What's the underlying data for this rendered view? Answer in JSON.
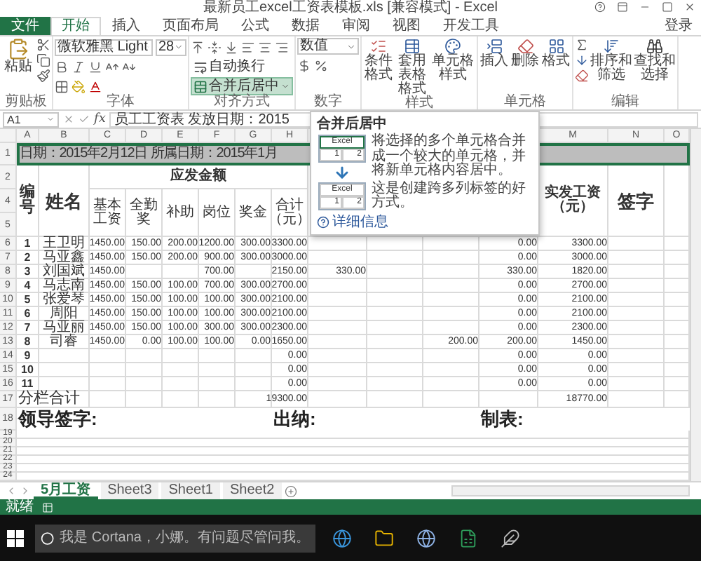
{
  "window": {
    "title": "最新员工excel工资表模板.xls [兼容模式] - Excel"
  },
  "tabs": [
    {
      "label": "文件",
      "kind": "file",
      "selected": false
    },
    {
      "label": "开始",
      "kind": "tab",
      "selected": true
    },
    {
      "label": "插入",
      "kind": "tab",
      "selected": false
    },
    {
      "label": "页面布局",
      "kind": "tab",
      "selected": false
    },
    {
      "label": "公式",
      "kind": "tab",
      "selected": false
    },
    {
      "label": "数据",
      "kind": "tab",
      "selected": false
    },
    {
      "label": "审阅",
      "kind": "tab",
      "selected": false
    },
    {
      "label": "视图",
      "kind": "tab",
      "selected": false
    },
    {
      "label": "开发工具",
      "kind": "tab",
      "selected": false
    }
  ],
  "account": "登录",
  "ribbon": {
    "clipboard": {
      "label": "剪贴板",
      "paste": "粘贴"
    },
    "font": {
      "label": "字体",
      "name": "微软雅黑 Light",
      "size": "28"
    },
    "alignment": {
      "label": "对齐方式",
      "wrap": "自动换行",
      "merge": "合并后居中",
      "merge_highlighted": true
    },
    "number": {
      "label": "数字",
      "format": "数值"
    },
    "styles": {
      "label": "样式",
      "buttons": [
        "条件格式",
        "套用表格格式",
        "单元格样式"
      ]
    },
    "cells": {
      "label": "单元格",
      "buttons": [
        "插入",
        "删除",
        "格式"
      ]
    },
    "editing": {
      "label": "编辑",
      "buttons": [
        "排序和筛选",
        "查找和选择"
      ]
    }
  },
  "formula_bar": {
    "cell": "A1",
    "fx": "fx",
    "value": "员工工资表  发放日期：2015"
  },
  "tooltip": {
    "title": "合并后居中",
    "paragraphs": [
      "将选择的多个单元格合并成一个较大的单元格，并将新单元格内容居中。",
      "这是创建跨多列标签的好方式。"
    ],
    "illustration": {
      "before": [
        "Excel",
        "1",
        "2"
      ],
      "after": [
        "Excel",
        "1",
        "2"
      ]
    },
    "link": "详细信息"
  },
  "sheet": {
    "column_letters": [
      "A",
      "B",
      "C",
      "D",
      "E",
      "F",
      "G",
      "H",
      "M",
      "N",
      "O"
    ],
    "title_row": {
      "row_number": "1",
      "text": "日期：2015年2月12日 所属日期：2015年1月",
      "selected": true
    },
    "header": {
      "row_numbers": [
        "2",
        "4",
        "5"
      ],
      "no": "编号",
      "name": "姓名",
      "payable": "应发金额",
      "payable_columns": [
        "基本工资",
        "全勤奖",
        "补助",
        "岗位",
        "奖金",
        "合计（元）"
      ],
      "net": "实发工资（元）",
      "sign": "签字"
    },
    "rows": [
      {
        "row_number": "6",
        "no": "1",
        "name": "王卫明",
        "base": "1450.00",
        "attendance": "150.00",
        "subsidy": "200.00",
        "post": "1200.00",
        "bonus": "300.00",
        "total": "3300.00",
        "column_12": "0.00",
        "net": "3300.00"
      },
      {
        "row_number": "7",
        "no": "2",
        "name": "马亚鑫",
        "base": "1450.00",
        "attendance": "150.00",
        "subsidy": "200.00",
        "post": "900.00",
        "bonus": "300.00",
        "total": "3000.00",
        "column_12": "0.00",
        "net": "3000.00"
      },
      {
        "row_number": "8",
        "no": "3",
        "name": "刘国斌",
        "base": "1450.00",
        "post": "700.00",
        "total": "2150.00",
        "column_9": "330.00",
        "column_12": "330.00",
        "net": "1820.00"
      },
      {
        "row_number": "9",
        "no": "4",
        "name": "马志南",
        "base": "1450.00",
        "attendance": "150.00",
        "subsidy": "100.00",
        "post": "700.00",
        "bonus": "300.00",
        "total": "2700.00",
        "column_12": "0.00",
        "net": "2700.00"
      },
      {
        "row_number": "10",
        "no": "5",
        "name": "张爱琴",
        "base": "1450.00",
        "attendance": "150.00",
        "subsidy": "100.00",
        "post": "100.00",
        "bonus": "300.00",
        "total": "2100.00",
        "column_12": "0.00",
        "net": "2100.00"
      },
      {
        "row_number": "11",
        "no": "6",
        "name": "周阳",
        "base": "1450.00",
        "attendance": "150.00",
        "subsidy": "100.00",
        "post": "100.00",
        "bonus": "300.00",
        "total": "2100.00",
        "column_12": "0.00",
        "net": "2100.00"
      },
      {
        "row_number": "12",
        "no": "7",
        "name": "马亚丽",
        "base": "1450.00",
        "attendance": "150.00",
        "subsidy": "100.00",
        "post": "300.00",
        "bonus": "300.00",
        "total": "2300.00",
        "column_12": "0.00",
        "net": "2300.00"
      },
      {
        "row_number": "13",
        "no": "8",
        "name": "司睿",
        "base": "1450.00",
        "attendance": "0.00",
        "subsidy": "100.00",
        "post": "100.00",
        "bonus": "0.00",
        "total": "1650.00",
        "column_11": "200.00",
        "column_12": "200.00",
        "net": "1450.00"
      },
      {
        "row_number": "14",
        "no": "9",
        "total": "0.00",
        "column_12": "0.00",
        "net": "0.00"
      },
      {
        "row_number": "15",
        "no": "10",
        "total": "0.00",
        "column_12": "0.00",
        "net": "0.00"
      },
      {
        "row_number": "16",
        "no": "11",
        "total": "0.00",
        "column_12": "0.00",
        "net": "0.00"
      }
    ],
    "total_row": {
      "row_number": "17",
      "label": "分栏合计",
      "total": "19300.00",
      "net": "18770.00"
    },
    "signature_row": {
      "row_number": "18",
      "labels": [
        "领导签字:",
        "出纳:",
        "制表:"
      ]
    },
    "empty_rows": [
      "19",
      "20",
      "21",
      "22",
      "23",
      "24"
    ]
  },
  "sheet_tabs": [
    {
      "label": "5月工资",
      "selected": true
    },
    {
      "label": "Sheet3",
      "selected": false
    },
    {
      "label": "Sheet1",
      "selected": false
    },
    {
      "label": "Sheet2",
      "selected": false
    }
  ],
  "status_bar": {
    "text": "就绪"
  },
  "taskbar": {
    "search_placeholder": "我是 Cortana，小娜。有问题尽管问我。"
  }
}
